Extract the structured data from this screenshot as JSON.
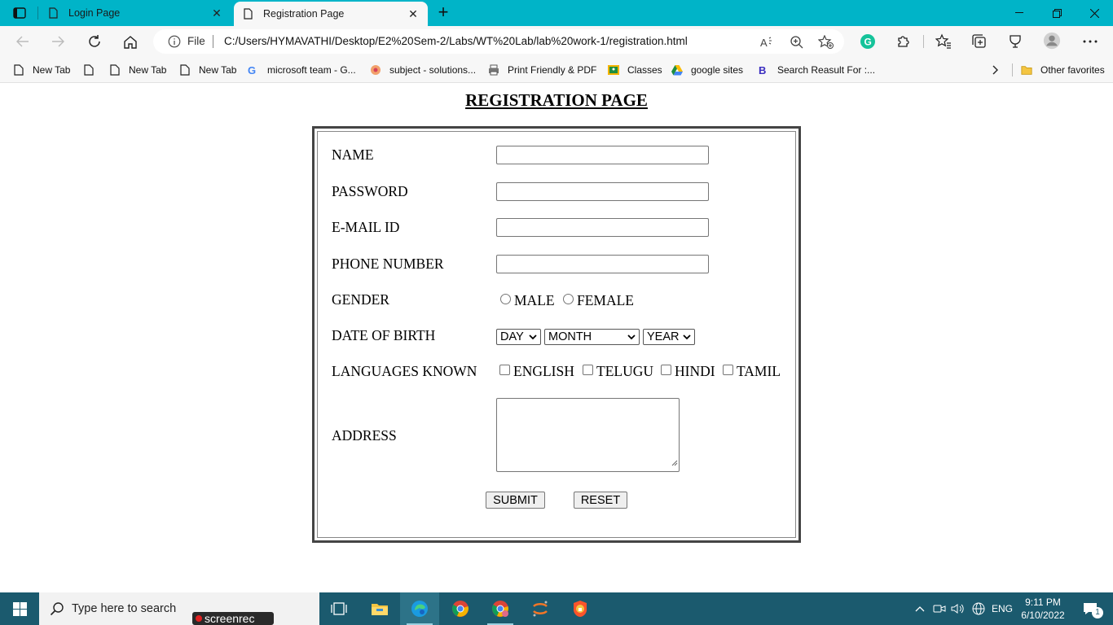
{
  "browser": {
    "tabs": [
      {
        "title": "Login Page",
        "active": false
      },
      {
        "title": "Registration Page",
        "active": true
      }
    ],
    "address": {
      "scheme_label": "File",
      "url": "C:/Users/HYMAVATHI/Desktop/E2%20Sem-2/Labs/WT%20Lab/lab%20work-1/registration.html"
    },
    "bookmarks": [
      {
        "label": "New Tab",
        "icon": "page-icon"
      },
      {
        "label": "",
        "icon": "page-icon"
      },
      {
        "label": "New Tab",
        "icon": "page-icon"
      },
      {
        "label": "New Tab",
        "icon": "page-icon"
      },
      {
        "label": "microsoft team - G...",
        "icon": "google-icon"
      },
      {
        "label": "subject - solutions...",
        "icon": "flower-icon"
      },
      {
        "label": "Print Friendly & PDF",
        "icon": "printer-icon"
      },
      {
        "label": "Classes",
        "icon": "classroom-icon"
      },
      {
        "label": "google sites",
        "icon": "drive-icon"
      },
      {
        "label": "Search Reasult For :...",
        "icon": "b-icon"
      }
    ],
    "other_favorites": "Other favorites"
  },
  "form": {
    "heading": "REGISTRATION PAGE",
    "fields": {
      "name_label": "NAME",
      "password_label": "PASSWORD",
      "email_label": "E-MAIL ID",
      "phone_label": "PHONE NUMBER",
      "gender_label": "GENDER",
      "dob_label": "DATE OF BIRTH",
      "languages_label": "LANGUAGES KNOWN",
      "address_label": "ADDRESS"
    },
    "gender_options": [
      "MALE",
      "FEMALE"
    ],
    "dob_selects": {
      "day": "DAY",
      "month": "MONTH",
      "year": "YEAR"
    },
    "languages": [
      "ENGLISH",
      "TELUGU",
      "HINDI",
      "TAMIL"
    ],
    "buttons": {
      "submit": "SUBMIT",
      "reset": "RESET"
    }
  },
  "taskbar": {
    "search_placeholder": "Type here to search",
    "screenrec_label": "screenrec",
    "language": "ENG",
    "time": "9:11 PM",
    "date": "6/10/2022",
    "notification_count": "1"
  },
  "colors": {
    "tab_strip": "#00b4c8",
    "taskbar": "#1b5a6e"
  }
}
